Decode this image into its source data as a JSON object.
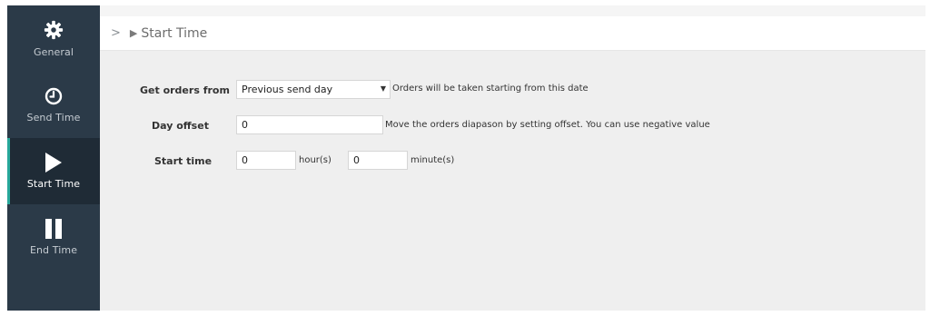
{
  "sidebar": {
    "items": [
      {
        "label": "General",
        "icon": "gear-icon"
      },
      {
        "label": "Send Time",
        "icon": "clock-icon"
      },
      {
        "label": "Start Time",
        "icon": "play-icon",
        "active": true
      },
      {
        "label": "End Time",
        "icon": "pause-icon"
      }
    ]
  },
  "header": {
    "chevron": ">",
    "play_glyph": "▶",
    "title": "Start Time"
  },
  "form": {
    "orders_from": {
      "label": "Get orders from",
      "value": "Previous send day",
      "hint": "Orders will be taken starting from this date"
    },
    "day_offset": {
      "label": "Day offset",
      "value": "0",
      "hint": "Move the orders diapason by setting offset. You can use negative value"
    },
    "start_time": {
      "label": "Start time",
      "hour_value": "0",
      "hour_unit": "hour(s)",
      "minute_value": "0",
      "minute_unit": "minute(s)"
    }
  },
  "colors": {
    "sidebar_bg": "#2b3a48",
    "sidebar_active_bg": "#1f2b36",
    "accent": "#28a89b",
    "content_bg": "#efefef"
  }
}
